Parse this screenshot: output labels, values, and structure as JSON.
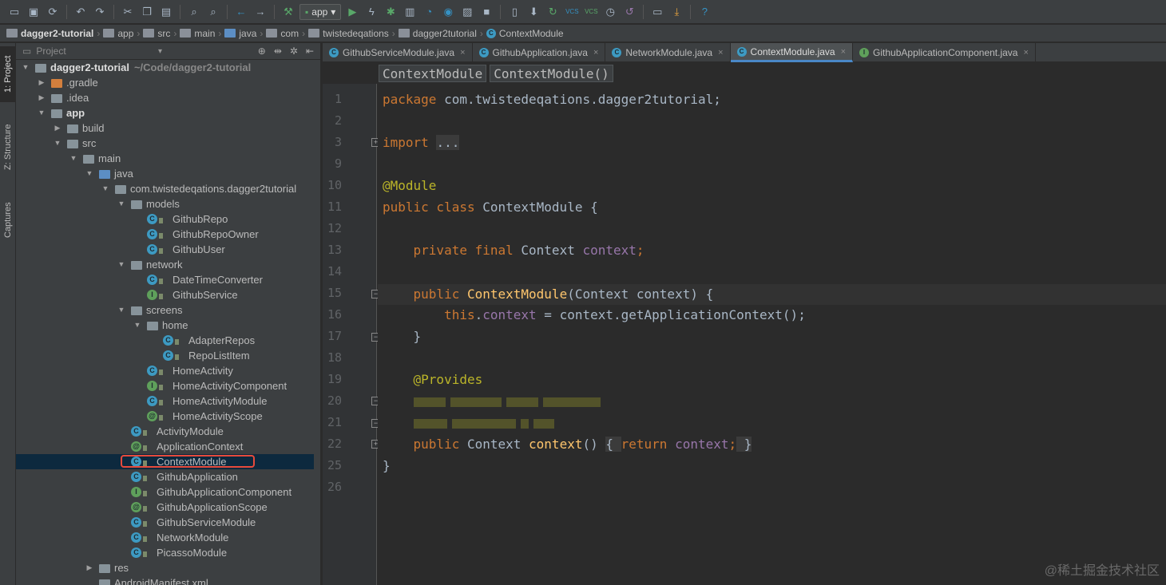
{
  "toolbar": {
    "run_config": "app",
    "icons": [
      "save-all-icon",
      "sync-icon",
      "undo-icon",
      "redo-icon",
      "cut-icon",
      "copy-icon",
      "paste-icon",
      "find-icon",
      "replace-icon",
      "back-icon",
      "forward-icon",
      "build-icon",
      "run-config-dropdown",
      "run-icon",
      "debug-icon",
      "profile-icon",
      "stop-icon",
      "sdk-manager-icon",
      "vcs-update-icon",
      "vcs-commit-icon",
      "help-icon"
    ],
    "vcs_label": "VCS"
  },
  "breadcrumb": [
    "dagger2-tutorial",
    "app",
    "src",
    "main",
    "java",
    "com",
    "twistedeqations",
    "dagger2tutorial",
    "ContextModule"
  ],
  "side_tabs": {
    "project": "1: Project",
    "structure": "Z: Structure",
    "captures": "Captures"
  },
  "project_panel": {
    "title": "Project"
  },
  "tree": [
    {
      "label": "dagger2-tutorial",
      "sub": "~/Code/dagger2-tutorial",
      "kind": "folder",
      "depth": 0,
      "open": true,
      "bold": true
    },
    {
      "label": ".gradle",
      "kind": "folder-orange",
      "depth": 1,
      "open": false
    },
    {
      "label": ".idea",
      "kind": "folder",
      "depth": 1,
      "open": false
    },
    {
      "label": "app",
      "kind": "folder",
      "depth": 1,
      "open": true,
      "bold": true
    },
    {
      "label": "build",
      "kind": "folder",
      "depth": 2,
      "open": false
    },
    {
      "label": "src",
      "kind": "folder",
      "depth": 2,
      "open": true
    },
    {
      "label": "main",
      "kind": "folder",
      "depth": 3,
      "open": true
    },
    {
      "label": "java",
      "kind": "folder-blue",
      "depth": 4,
      "open": true
    },
    {
      "label": "com.twistedeqations.dagger2tutorial",
      "kind": "package",
      "depth": 5,
      "open": true
    },
    {
      "label": "models",
      "kind": "package",
      "depth": 6,
      "open": true
    },
    {
      "label": "GithubRepo",
      "kind": "C",
      "depth": 7
    },
    {
      "label": "GithubRepoOwner",
      "kind": "C",
      "depth": 7
    },
    {
      "label": "GithubUser",
      "kind": "C",
      "depth": 7
    },
    {
      "label": "network",
      "kind": "package",
      "depth": 6,
      "open": true
    },
    {
      "label": "DateTimeConverter",
      "kind": "C",
      "depth": 7
    },
    {
      "label": "GithubService",
      "kind": "I",
      "depth": 7
    },
    {
      "label": "screens",
      "kind": "package",
      "depth": 6,
      "open": true
    },
    {
      "label": "home",
      "kind": "package",
      "depth": 7,
      "open": true
    },
    {
      "label": "AdapterRepos",
      "kind": "C",
      "depth": 8
    },
    {
      "label": "RepoListItem",
      "kind": "C",
      "depth": 8
    },
    {
      "label": "HomeActivity",
      "kind": "C",
      "depth": 7
    },
    {
      "label": "HomeActivityComponent",
      "kind": "I",
      "depth": 7
    },
    {
      "label": "HomeActivityModule",
      "kind": "C",
      "depth": 7
    },
    {
      "label": "HomeActivityScope",
      "kind": "@",
      "depth": 7
    },
    {
      "label": "ActivityModule",
      "kind": "C",
      "depth": 6
    },
    {
      "label": "ApplicationContext",
      "kind": "@",
      "depth": 6
    },
    {
      "label": "ContextModule",
      "kind": "C",
      "depth": 6,
      "selected": true
    },
    {
      "label": "GithubApplication",
      "kind": "C",
      "depth": 6
    },
    {
      "label": "GithubApplicationComponent",
      "kind": "I",
      "depth": 6
    },
    {
      "label": "GithubApplicationScope",
      "kind": "@",
      "depth": 6
    },
    {
      "label": "GithubServiceModule",
      "kind": "C",
      "depth": 6
    },
    {
      "label": "NetworkModule",
      "kind": "C",
      "depth": 6
    },
    {
      "label": "PicassoModule",
      "kind": "C",
      "depth": 6
    },
    {
      "label": "res",
      "kind": "folder",
      "depth": 4,
      "open": false
    },
    {
      "label": "AndroidManifest.xml",
      "kind": "file",
      "depth": 4
    }
  ],
  "tabs": [
    {
      "label": "GithubServiceModule.java",
      "icon": "C",
      "active": false
    },
    {
      "label": "GithubApplication.java",
      "icon": "C",
      "active": false
    },
    {
      "label": "NetworkModule.java",
      "icon": "C",
      "active": false
    },
    {
      "label": "ContextModule.java",
      "icon": "C",
      "active": true
    },
    {
      "label": "GithubApplicationComponent.java",
      "icon": "I",
      "active": false
    }
  ],
  "editor_crumbs": [
    "ContextModule",
    "ContextModule()"
  ],
  "line_numbers": [
    "1",
    "2",
    "3",
    "9",
    "10",
    "11",
    "12",
    "13",
    "14",
    "15",
    "16",
    "17",
    "18",
    "19",
    "20",
    "21",
    "22",
    "25",
    "26"
  ],
  "code": {
    "l1": "package com.twistedeqations.dagger2tutorial;",
    "l3_kw": "import",
    "l3_fold": "...",
    "l10": "@Module",
    "l11_kw": "public class",
    "l11_rest": " ContextModule {",
    "l13_kw": "private final",
    "l13_type": " Context ",
    "l13_field": "context",
    "l13_end": ";",
    "l15_kw": "public",
    "l15_name": "ContextModule",
    "l15_rest": "(Context context) {",
    "l16_this": "this",
    "l16_dot": ".",
    "l16_field": "context",
    "l16_rest": " = context.getApplicationContext();",
    "l17": "}",
    "l19": "@Provides",
    "l22_kw": "public",
    "l22_type": " Context ",
    "l22_name": "context",
    "l22_paren": "() ",
    "l22_fold_open": "{ ",
    "l22_ret": "return",
    "l22_field": " context",
    "l22_semi": ";",
    "l22_fold_close": " }",
    "l25": "}"
  },
  "watermark": "@稀土掘金技术社区"
}
